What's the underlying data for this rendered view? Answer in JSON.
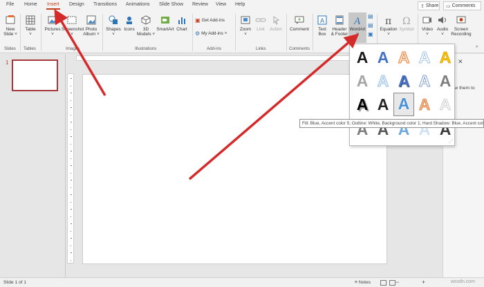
{
  "tabs": [
    "File",
    "Home",
    "Insert",
    "Design",
    "Transitions",
    "Animations",
    "Slide Show",
    "Review",
    "View",
    "Help"
  ],
  "active_tab": "Insert",
  "share_label": "Share",
  "comments_label": "Comments",
  "ribbon": {
    "new_slide": [
      "New",
      "Slide ˅"
    ],
    "table": [
      "Table",
      "˅"
    ],
    "pictures": [
      "Pictures",
      "˅"
    ],
    "screenshot": [
      "Screenshot",
      "˅"
    ],
    "photo_album": [
      "Photo",
      "Album ˅"
    ],
    "shapes": [
      "Shapes",
      "˅"
    ],
    "icons": "Icons",
    "models_3d": [
      "3D",
      "Models ˅"
    ],
    "smartart": "SmartArt",
    "chart": "Chart",
    "get_addins": "Get Add-ins",
    "my_addins": "My Add-ins",
    "zoom": [
      "Zoom",
      "˅"
    ],
    "link": "Link",
    "action": "Action",
    "comment": "Comment",
    "text_box": [
      "Text",
      "Box"
    ],
    "header_footer": [
      "Header",
      "& Footer"
    ],
    "wordart": [
      "WordArt",
      "˅"
    ],
    "equation": [
      "Equation",
      "˅"
    ],
    "symbol": "Symbol",
    "video": [
      "Video",
      "˅"
    ],
    "audio": [
      "Audio",
      "˅"
    ],
    "screen_recording": [
      "Screen",
      "Recording"
    ]
  },
  "groups": {
    "slides": "Slides",
    "tables": "Tables",
    "images": "Images",
    "illustrations": "Illustrations",
    "addins": "Add-ins",
    "links": "Links",
    "comments": "Comments",
    "text": "Te"
  },
  "thumbnail_number": "1",
  "right_pane_text": "low them to",
  "wordart_letter": "A",
  "tooltip": "Fill: Blue, Accent color 5; Outline: White, Background color 1; Hard Shadow: Blue, Accent color 5",
  "status": {
    "slide_info": "Slide 1 of 1",
    "notes": "Notes"
  },
  "watermark": "wsxdn.com",
  "colors": {
    "accent_red": "#c43e1c",
    "arrow": "#d42a2a",
    "accent_blue": "#4472c4"
  }
}
